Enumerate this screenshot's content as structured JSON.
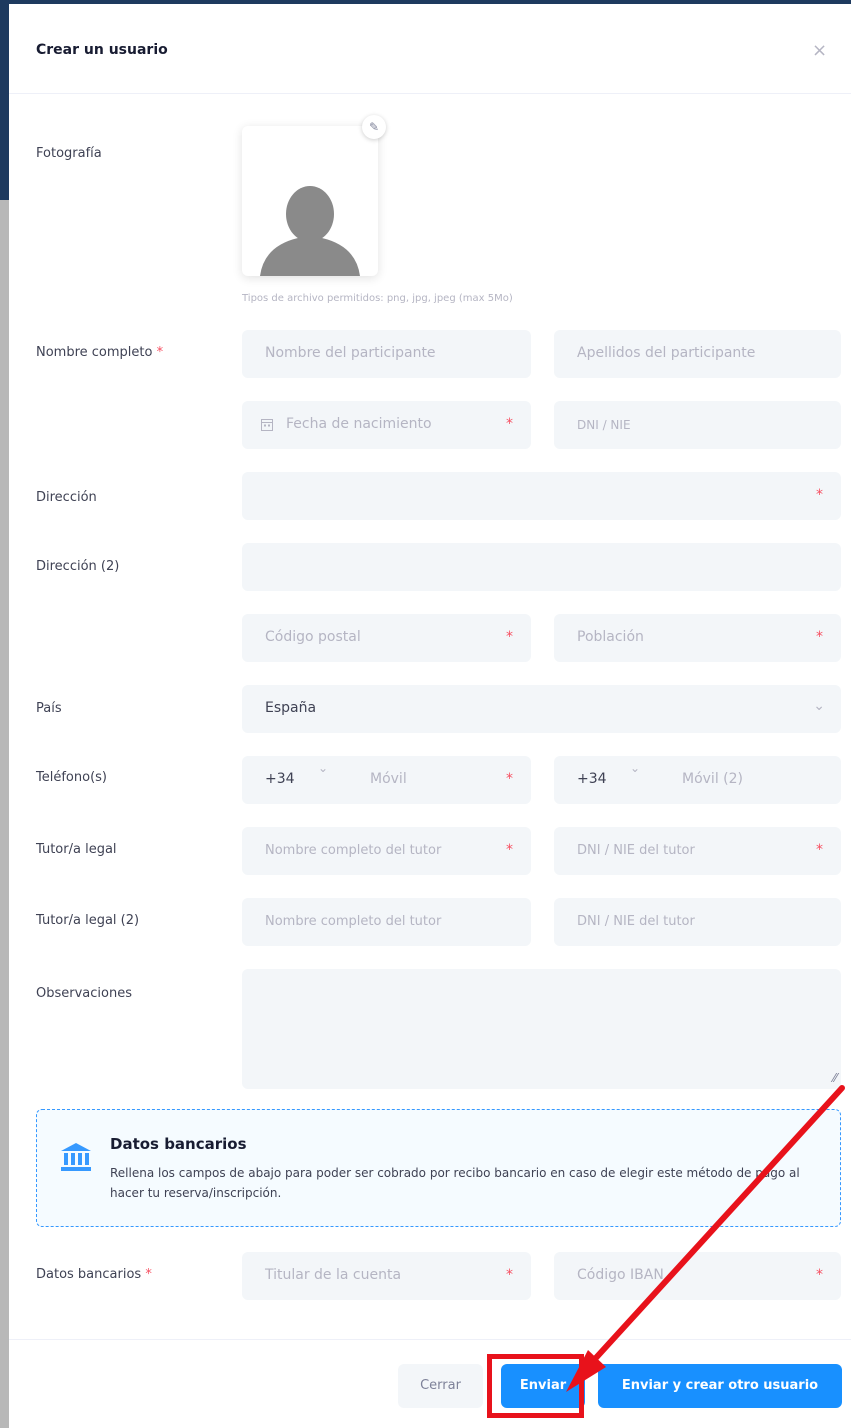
{
  "modal": {
    "title": "Crear un usuario",
    "close_glyph": "×"
  },
  "photo": {
    "label": "Fotografía",
    "edit_glyph": "✎",
    "hint": "Tipos de archivo permitidos: png, jpg, jpeg (max 5Mo)"
  },
  "fullname": {
    "label": "Nombre completo",
    "first_placeholder": "Nombre del participante",
    "last_placeholder": "Apellidos del participante",
    "birth_placeholder": "Fecha de nacimiento",
    "dni_placeholder": "DNI / NIE"
  },
  "address": {
    "label": "Dirección",
    "label2": "Dirección (2)",
    "zip_placeholder": "Código postal",
    "city_placeholder": "Población"
  },
  "country": {
    "label": "País",
    "value": "España"
  },
  "phone": {
    "label": "Teléfono(s)",
    "prefix1": "+34",
    "mobile_placeholder": "Móvil",
    "prefix2": "+34",
    "mobile2_placeholder": "Móvil (2)"
  },
  "tutor": {
    "label": "Tutor/a legal",
    "name_placeholder": "Nombre completo del tutor",
    "dni_placeholder": "DNI / NIE del tutor",
    "label2": "Tutor/a legal (2)",
    "name2_placeholder": "Nombre completo del tutor",
    "dni2_placeholder": "DNI / NIE del tutor"
  },
  "notes": {
    "label": "Observaciones"
  },
  "bank_notice": {
    "title": "Datos bancarios",
    "text": "Rellena los campos de abajo para poder ser cobrado por recibo bancario en caso de elegir este método de pago al hacer tu reserva/inscripción."
  },
  "bank": {
    "label": "Datos bancarios",
    "holder_placeholder": "Titular de la cuenta",
    "iban_placeholder": "Código IBAN"
  },
  "footer": {
    "close_label": "Cerrar",
    "send_label": "Enviar",
    "send_and_new_label": "Enviar y crear otro usuario"
  },
  "symbols": {
    "required": "*",
    "chevron": "⌄",
    "resize": "⁄⁄"
  },
  "colors": {
    "primary": "#1890ff",
    "required": "#f64e60",
    "annotation": "#e8121b"
  }
}
